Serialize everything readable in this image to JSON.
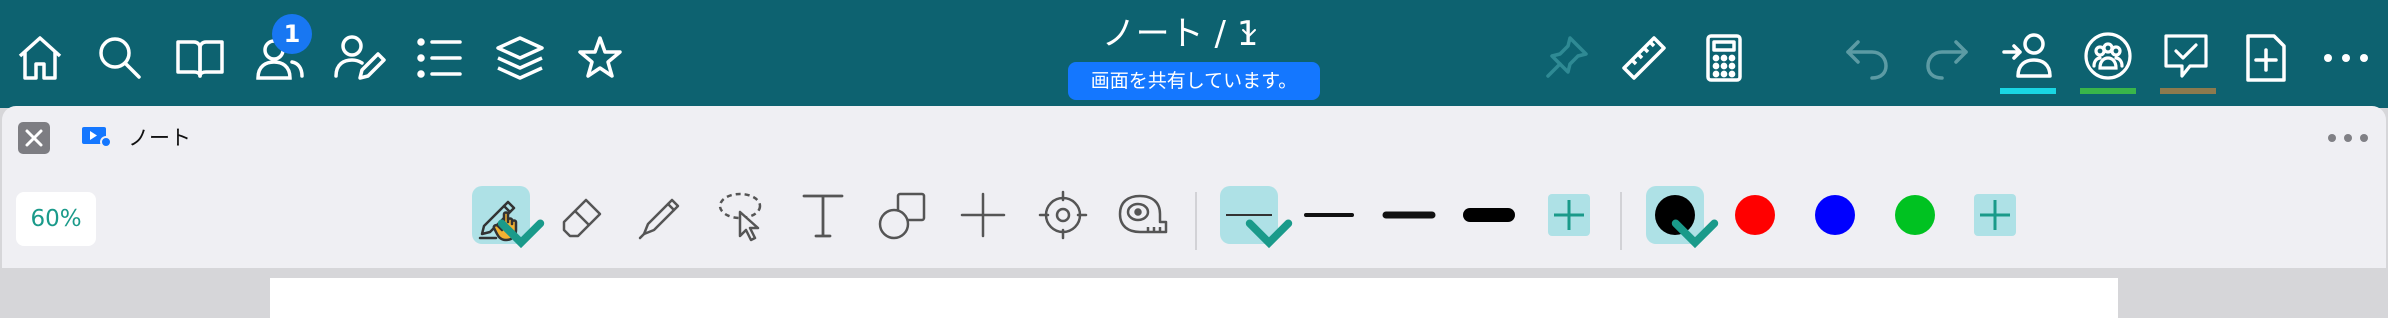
{
  "topbar": {
    "notification_count": "1",
    "document_title": "ノート / 1",
    "share_status": "画面を共有しています。",
    "indicator_colors": {
      "people": "#19d6e3",
      "group": "#39b54a",
      "comment": "#8c7a4e"
    }
  },
  "panel": {
    "title": "ノート",
    "zoom": "60%"
  },
  "colors": {
    "accent": "#0d6270",
    "selection": "#aee1e6",
    "swatches": [
      "#000000",
      "#ff0000",
      "#0000ff",
      "#00c221"
    ]
  },
  "icons": {
    "left": [
      "home-icon",
      "search-icon",
      "book-icon",
      "people-icon",
      "person-edit-icon",
      "list-icon",
      "layers-icon",
      "star-icon"
    ],
    "right": [
      "pin-icon",
      "ruler-icon",
      "calculator-icon",
      "undo-icon",
      "redo-icon",
      "person-add-icon",
      "group-icon",
      "comment-icon",
      "new-page-icon",
      "more-icon"
    ]
  }
}
